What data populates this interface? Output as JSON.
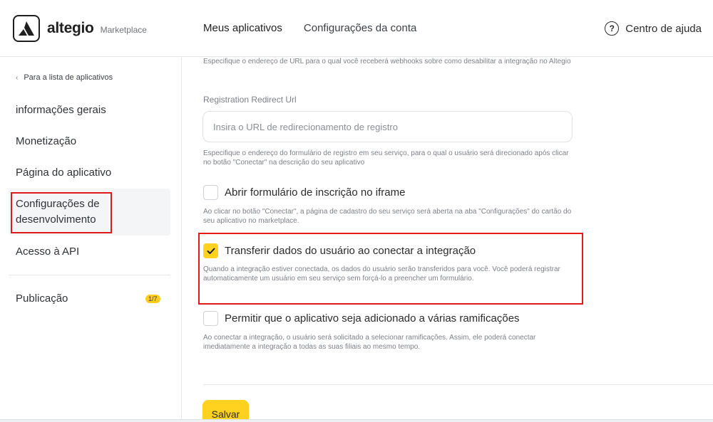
{
  "header": {
    "logo_text": "altegio",
    "logo_sub": "Marketplace",
    "nav": [
      "Meus aplicativos",
      "Configurações da conta"
    ],
    "help_label": "Centro de ajuda",
    "help_icon": "question-circle-icon"
  },
  "sidebar": {
    "back_label": "Para a lista de aplicativos",
    "items": [
      {
        "label": "informações gerais"
      },
      {
        "label": "Monetização"
      },
      {
        "label": "Página do aplicativo"
      },
      {
        "label": "Configurações de desenvolvimento",
        "active": true
      },
      {
        "label": "Acesso à API"
      },
      {
        "label": "Publicação",
        "badge": "1/7"
      }
    ]
  },
  "main": {
    "webhook_hint": "Especifique o endereço de URL para o qual você receberá webhooks sobre como desabilitar a integração no Altegio",
    "redirect_label": "Registration Redirect Url",
    "redirect_placeholder": "Insira o URL de redirecionamento de registro",
    "redirect_value": "",
    "redirect_hint": "Especifique o endereço do formulário de registro em seu serviço, para o qual o usuário será direcionado após clicar no botão \"Conectar\" na descrição do seu aplicativo",
    "checkboxes": [
      {
        "label": "Abrir formulário de inscrição no iframe",
        "checked": false,
        "hint": "Ao clicar no botão \"Conectar\", a página de cadastro do seu serviço será aberta na aba \"Configurações\" do cartão do seu aplicativo no marketplace."
      },
      {
        "label": "Transferir dados do usuário ao conectar a integração",
        "checked": true,
        "hint": "Quando a integração estiver conectada, os dados do usuário serão transferidos para você. Você poderá registrar automaticamente um usuário em seu serviço sem forçá-lo a preencher um formulário."
      },
      {
        "label": "Permitir que o aplicativo seja adicionado a várias ramificações",
        "checked": false,
        "hint": "Ao conectar a integração, o usuário será solicitado a selecionar ramificações. Assim, ele poderá conectar imediatamente a integração a todas as suas filiais ao mesmo tempo."
      }
    ],
    "save_label": "Salvar"
  },
  "colors": {
    "accent": "#ffd21f",
    "highlight": "#e01a1a"
  }
}
